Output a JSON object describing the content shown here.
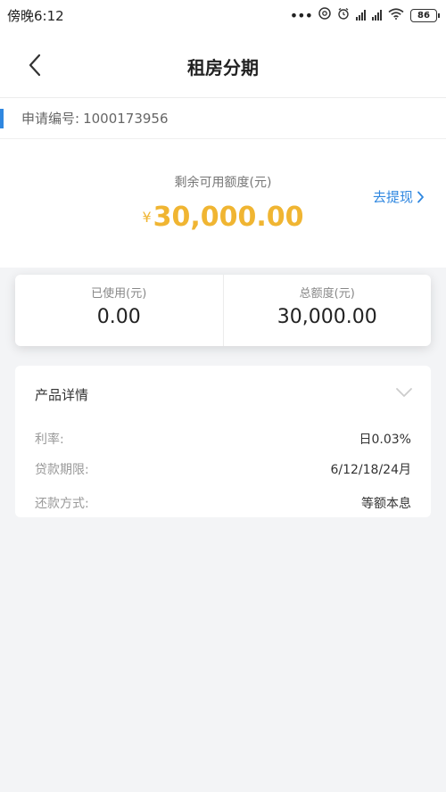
{
  "status_bar": {
    "time": "傍晚6:12",
    "battery": "86",
    "icons": [
      "more-dots-icon",
      "nfc-icon",
      "alarm-icon",
      "signal-icon",
      "hd-signal-icon",
      "wifi-icon",
      "battery-icon"
    ]
  },
  "nav": {
    "title": "租房分期",
    "back_icon": "chevron-left-icon"
  },
  "application": {
    "label": "申请编号:",
    "number": "1000173956"
  },
  "credit": {
    "label": "剩余可用额度(元)",
    "currency_symbol": "¥",
    "amount": "30,000.00",
    "withdraw_label": "去提现",
    "amount_color": "#f0b532",
    "link_color": "#2f87e0"
  },
  "quota": {
    "used_label": "已使用(元)",
    "used_value": "0.00",
    "total_label": "总额度(元)",
    "total_value": "30,000.00"
  },
  "product": {
    "header": "产品详情",
    "rows": [
      {
        "key": "利率:",
        "value": "日0.03%"
      },
      {
        "key": "贷款期限:",
        "value": "6/12/18/24月"
      },
      {
        "key": "还款方式:",
        "value": "等额本息"
      }
    ]
  }
}
